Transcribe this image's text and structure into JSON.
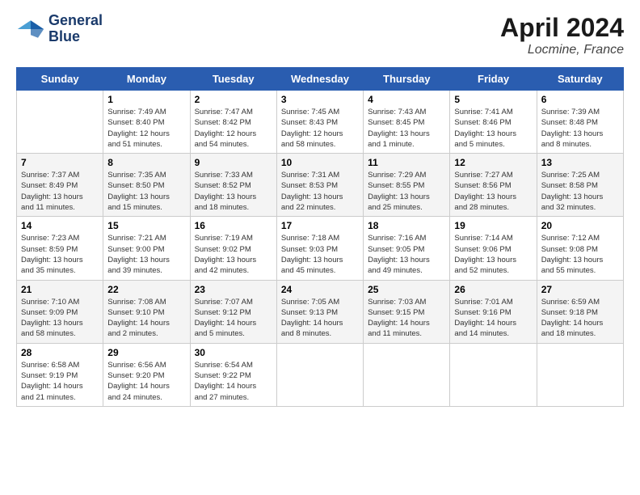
{
  "logo": {
    "line1": "General",
    "line2": "Blue"
  },
  "title": {
    "month": "April 2024",
    "location": "Locmine, France"
  },
  "weekdays": [
    "Sunday",
    "Monday",
    "Tuesday",
    "Wednesday",
    "Thursday",
    "Friday",
    "Saturday"
  ],
  "weeks": [
    [
      {
        "day": "",
        "info": ""
      },
      {
        "day": "1",
        "info": "Sunrise: 7:49 AM\nSunset: 8:40 PM\nDaylight: 12 hours\nand 51 minutes."
      },
      {
        "day": "2",
        "info": "Sunrise: 7:47 AM\nSunset: 8:42 PM\nDaylight: 12 hours\nand 54 minutes."
      },
      {
        "day": "3",
        "info": "Sunrise: 7:45 AM\nSunset: 8:43 PM\nDaylight: 12 hours\nand 58 minutes."
      },
      {
        "day": "4",
        "info": "Sunrise: 7:43 AM\nSunset: 8:45 PM\nDaylight: 13 hours\nand 1 minute."
      },
      {
        "day": "5",
        "info": "Sunrise: 7:41 AM\nSunset: 8:46 PM\nDaylight: 13 hours\nand 5 minutes."
      },
      {
        "day": "6",
        "info": "Sunrise: 7:39 AM\nSunset: 8:48 PM\nDaylight: 13 hours\nand 8 minutes."
      }
    ],
    [
      {
        "day": "7",
        "info": "Sunrise: 7:37 AM\nSunset: 8:49 PM\nDaylight: 13 hours\nand 11 minutes."
      },
      {
        "day": "8",
        "info": "Sunrise: 7:35 AM\nSunset: 8:50 PM\nDaylight: 13 hours\nand 15 minutes."
      },
      {
        "day": "9",
        "info": "Sunrise: 7:33 AM\nSunset: 8:52 PM\nDaylight: 13 hours\nand 18 minutes."
      },
      {
        "day": "10",
        "info": "Sunrise: 7:31 AM\nSunset: 8:53 PM\nDaylight: 13 hours\nand 22 minutes."
      },
      {
        "day": "11",
        "info": "Sunrise: 7:29 AM\nSunset: 8:55 PM\nDaylight: 13 hours\nand 25 minutes."
      },
      {
        "day": "12",
        "info": "Sunrise: 7:27 AM\nSunset: 8:56 PM\nDaylight: 13 hours\nand 28 minutes."
      },
      {
        "day": "13",
        "info": "Sunrise: 7:25 AM\nSunset: 8:58 PM\nDaylight: 13 hours\nand 32 minutes."
      }
    ],
    [
      {
        "day": "14",
        "info": "Sunrise: 7:23 AM\nSunset: 8:59 PM\nDaylight: 13 hours\nand 35 minutes."
      },
      {
        "day": "15",
        "info": "Sunrise: 7:21 AM\nSunset: 9:00 PM\nDaylight: 13 hours\nand 39 minutes."
      },
      {
        "day": "16",
        "info": "Sunrise: 7:19 AM\nSunset: 9:02 PM\nDaylight: 13 hours\nand 42 minutes."
      },
      {
        "day": "17",
        "info": "Sunrise: 7:18 AM\nSunset: 9:03 PM\nDaylight: 13 hours\nand 45 minutes."
      },
      {
        "day": "18",
        "info": "Sunrise: 7:16 AM\nSunset: 9:05 PM\nDaylight: 13 hours\nand 49 minutes."
      },
      {
        "day": "19",
        "info": "Sunrise: 7:14 AM\nSunset: 9:06 PM\nDaylight: 13 hours\nand 52 minutes."
      },
      {
        "day": "20",
        "info": "Sunrise: 7:12 AM\nSunset: 9:08 PM\nDaylight: 13 hours\nand 55 minutes."
      }
    ],
    [
      {
        "day": "21",
        "info": "Sunrise: 7:10 AM\nSunset: 9:09 PM\nDaylight: 13 hours\nand 58 minutes."
      },
      {
        "day": "22",
        "info": "Sunrise: 7:08 AM\nSunset: 9:10 PM\nDaylight: 14 hours\nand 2 minutes."
      },
      {
        "day": "23",
        "info": "Sunrise: 7:07 AM\nSunset: 9:12 PM\nDaylight: 14 hours\nand 5 minutes."
      },
      {
        "day": "24",
        "info": "Sunrise: 7:05 AM\nSunset: 9:13 PM\nDaylight: 14 hours\nand 8 minutes."
      },
      {
        "day": "25",
        "info": "Sunrise: 7:03 AM\nSunset: 9:15 PM\nDaylight: 14 hours\nand 11 minutes."
      },
      {
        "day": "26",
        "info": "Sunrise: 7:01 AM\nSunset: 9:16 PM\nDaylight: 14 hours\nand 14 minutes."
      },
      {
        "day": "27",
        "info": "Sunrise: 6:59 AM\nSunset: 9:18 PM\nDaylight: 14 hours\nand 18 minutes."
      }
    ],
    [
      {
        "day": "28",
        "info": "Sunrise: 6:58 AM\nSunset: 9:19 PM\nDaylight: 14 hours\nand 21 minutes."
      },
      {
        "day": "29",
        "info": "Sunrise: 6:56 AM\nSunset: 9:20 PM\nDaylight: 14 hours\nand 24 minutes."
      },
      {
        "day": "30",
        "info": "Sunrise: 6:54 AM\nSunset: 9:22 PM\nDaylight: 14 hours\nand 27 minutes."
      },
      {
        "day": "",
        "info": ""
      },
      {
        "day": "",
        "info": ""
      },
      {
        "day": "",
        "info": ""
      },
      {
        "day": "",
        "info": ""
      }
    ]
  ]
}
